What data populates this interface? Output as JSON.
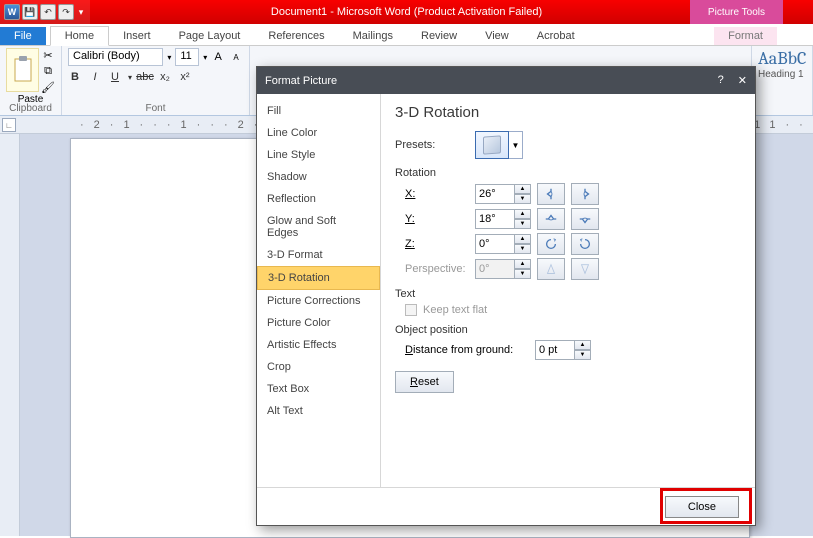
{
  "title": "Document1 - Microsoft Word (Product Activation Failed)",
  "picture_tools": "Picture Tools",
  "tabs": {
    "file": "File",
    "home": "Home",
    "insert": "Insert",
    "page_layout": "Page Layout",
    "references": "References",
    "mailings": "Mailings",
    "review": "Review",
    "view": "View",
    "acrobat": "Acrobat",
    "format": "Format"
  },
  "ribbon": {
    "paste": "Paste",
    "clipboard": "Clipboard",
    "font_name": "Calibri (Body)",
    "font_size": "11",
    "font_group": "Font",
    "style_preview": "AaBbC",
    "style_name": "Heading 1"
  },
  "dialog": {
    "title": "Format Picture",
    "side": [
      "Fill",
      "Line Color",
      "Line Style",
      "Shadow",
      "Reflection",
      "Glow and Soft Edges",
      "3-D Format",
      "3-D Rotation",
      "Picture Corrections",
      "Picture Color",
      "Artistic Effects",
      "Crop",
      "Text Box",
      "Alt Text"
    ],
    "heading": "3-D Rotation",
    "presets": "Presets:",
    "rotation": "Rotation",
    "x": "X:",
    "x_val": "26°",
    "y": "Y:",
    "y_val": "18°",
    "z": "Z:",
    "z_val": "0°",
    "perspective": "Perspective:",
    "persp_val": "0°",
    "text": "Text",
    "keep_flat": "Keep text flat",
    "obj_pos": "Object position",
    "dist": "Distance from ground:",
    "dist_val": "0 pt",
    "reset": "Reset",
    "close": "Close"
  }
}
